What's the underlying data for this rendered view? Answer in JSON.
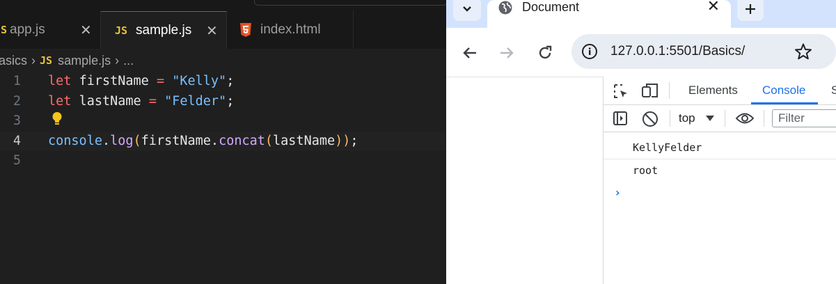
{
  "editor": {
    "tabs": [
      {
        "icon": "JS",
        "label": "app.js",
        "close": "✕"
      },
      {
        "icon": "JS",
        "label": "sample.js",
        "close": "✕"
      },
      {
        "icon": "html5-icon",
        "label": "index.html"
      }
    ],
    "breadcrumb": {
      "folder": "asics",
      "file_icon": "JS",
      "file": "sample.js",
      "more": "..."
    },
    "line_numbers": [
      "1",
      "2",
      "3",
      "4",
      "5"
    ],
    "code": {
      "l1": {
        "kw": "let",
        "name": "firstName",
        "op": "=",
        "str": "\"Kelly\"",
        "end": ";"
      },
      "l2": {
        "kw": "let",
        "name": "lastName",
        "op": "=",
        "str": "\"Felder\"",
        "end": ";"
      },
      "l4": {
        "obj": "console",
        "dot1": ".",
        "fn": "log",
        "p1": "(",
        "arg": "firstName",
        "dot2": ".",
        "fn2": "concat",
        "p2": "(",
        "arg2": "lastName",
        "p3": ")",
        "p4": ")",
        "end": ";"
      }
    },
    "active_line": 4,
    "colors": {
      "background": "#1f1f1f",
      "keyword": "#ff6b6b",
      "string": "#79c0ff",
      "function": "#d2a8ff",
      "js_icon": "#e8c33a"
    }
  },
  "browser": {
    "tab": {
      "title": "Document",
      "close": "✕"
    },
    "url": "127.0.0.1:5501/Basics/",
    "devtools": {
      "tabs": [
        "Elements",
        "Console",
        "S"
      ],
      "active_tab": "Console",
      "context": "top",
      "filter_placeholder": "Filter",
      "messages": [
        "KellyFelder",
        "root"
      ],
      "prompt": "›"
    },
    "colors": {
      "tabstrip": "#d3e3fd",
      "omnibox": "#e8ecf3",
      "accent": "#1a73e8"
    }
  }
}
